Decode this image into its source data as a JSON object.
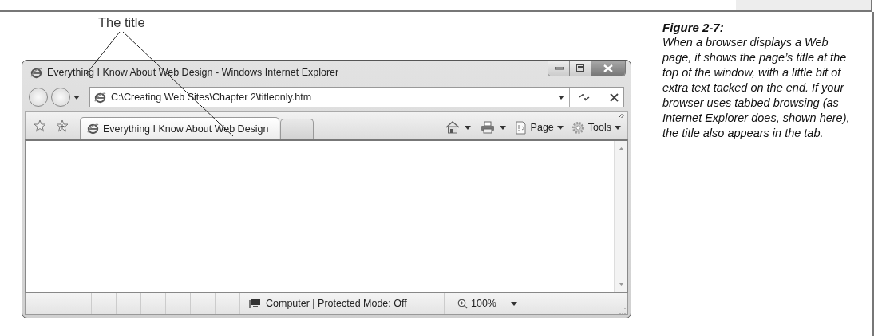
{
  "callout": {
    "label": "The title"
  },
  "browser": {
    "title": "Everything I Know About Web Design - Windows Internet Explorer",
    "address": "C:\\Creating Web Sites\\Chapter 2\\titleonly.htm",
    "tabs": [
      {
        "kind": "page",
        "label": "Everything I Know About Web Design",
        "selected": true
      },
      {
        "kind": "new",
        "selected": false
      }
    ],
    "commands": [
      {
        "kind": "page",
        "label": "Page"
      },
      {
        "kind": "tools",
        "label": "Tools"
      }
    ],
    "status": "Computer | Protected Mode: Off",
    "zoom": "100%"
  },
  "caption": {
    "figure": "Figure 2-7:",
    "text": "When a browser displays a Web page, it shows the page’s title at the top of the window, with a little bit of extra text tacked on the end. If your browser uses tabbed browsing (as Internet Explorer does, shown here), the title also appears in the tab."
  }
}
